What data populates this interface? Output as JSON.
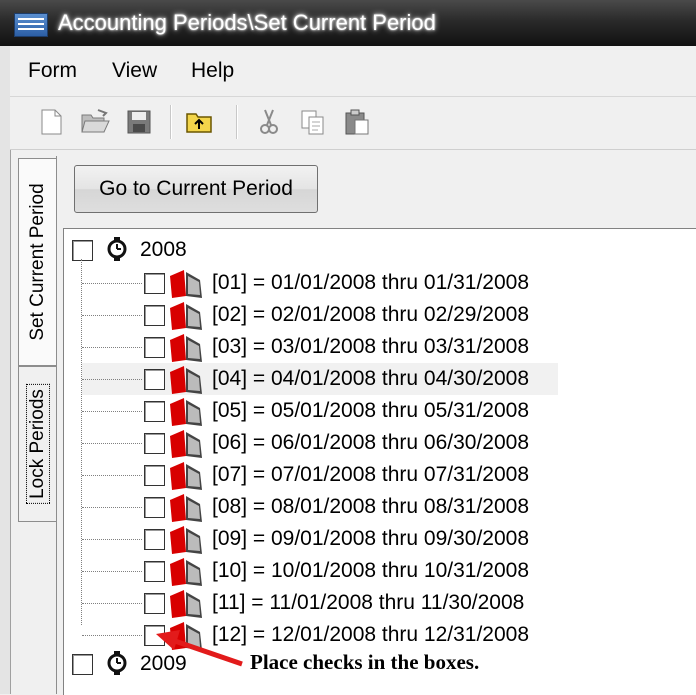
{
  "window": {
    "title": "Accounting Periods\\Set Current Period"
  },
  "menu": [
    "Form",
    "View",
    "Help"
  ],
  "toolbar": {
    "icons": [
      "new-document-icon",
      "open-folder-icon",
      "save-icon",
      "folder-up-icon",
      "cut-icon",
      "copy-icon",
      "paste-icon"
    ]
  },
  "tabs": [
    {
      "label": "Set Current Period",
      "active": true
    },
    {
      "label": "Lock Periods",
      "active": false
    }
  ],
  "goto_button": "Go to Current Period",
  "tree": {
    "years": [
      {
        "label": "2008",
        "checked": false,
        "periods": [
          {
            "label": "[01] = 01/01/2008 thru 01/31/2008",
            "checked": false
          },
          {
            "label": "[02] = 02/01/2008 thru 02/29/2008",
            "checked": false
          },
          {
            "label": "[03] = 03/01/2008 thru 03/31/2008",
            "checked": false
          },
          {
            "label": "[04] = 04/01/2008 thru 04/30/2008",
            "checked": false
          },
          {
            "label": "[05] = 05/01/2008 thru 05/31/2008",
            "checked": false
          },
          {
            "label": "[06] = 06/01/2008 thru 06/30/2008",
            "checked": false
          },
          {
            "label": "[07] = 07/01/2008 thru 07/31/2008",
            "checked": false
          },
          {
            "label": "[08] = 08/01/2008 thru 08/31/2008",
            "checked": false
          },
          {
            "label": "[09] = 09/01/2008 thru 09/30/2008",
            "checked": false
          },
          {
            "label": "[10] = 10/01/2008 thru 10/31/2008",
            "checked": false
          },
          {
            "label": "[11] = 11/01/2008 thru 11/30/2008",
            "checked": false
          },
          {
            "label": "[12] = 12/01/2008 thru 12/31/2008",
            "checked": false
          }
        ]
      },
      {
        "label": "2009",
        "checked": false,
        "periods": []
      }
    ]
  },
  "annotation": "Place checks in the boxes.",
  "colors": {
    "arrow": "#e21b1b",
    "book": "#d80000",
    "titlebar": "#2a2a2a"
  }
}
